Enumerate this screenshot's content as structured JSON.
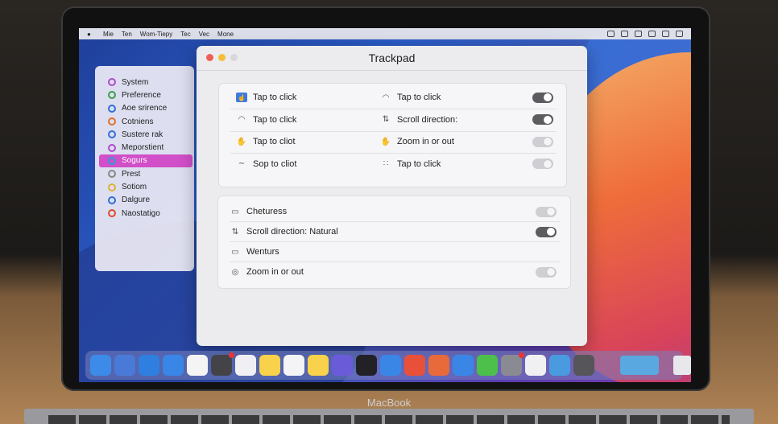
{
  "menubar": {
    "items": [
      "Mie",
      "Ten",
      "Wom-Tiepy",
      "Tec",
      "Vec",
      "Mone"
    ]
  },
  "sidebar": {
    "items": [
      {
        "label": "System",
        "color": "#b04ad0"
      },
      {
        "label": "Preference",
        "color": "#3aa04a"
      },
      {
        "label": "Aoe srirence",
        "color": "#2f6fd8"
      },
      {
        "label": "Cotniens",
        "color": "#e07030"
      },
      {
        "label": "Sustere rak",
        "color": "#2f6fd8"
      },
      {
        "label": "Meporstient",
        "color": "#b04ad0"
      },
      {
        "label": "Sogurs",
        "color": "#2f9ad8",
        "selected": true
      },
      {
        "label": "Prest",
        "color": "#888888"
      },
      {
        "label": "Sotiom",
        "color": "#e0b030"
      },
      {
        "label": "Dalgure",
        "color": "#2f6fd8"
      },
      {
        "label": "Naostatigo",
        "color": "#e04a2a"
      }
    ]
  },
  "window": {
    "title": "Trackpad",
    "group1": [
      {
        "left": {
          "icon": "tap-icon",
          "label": "Tap to click"
        },
        "right": {
          "icon": "tap-gesture-icon",
          "label": "Tap to click",
          "toggle": "on"
        }
      },
      {
        "left": {
          "icon": "tap-gesture-icon",
          "label": "Tap to click"
        },
        "right": {
          "icon": "scroll-icon",
          "label": "Scroll direction:",
          "toggle": "on"
        }
      },
      {
        "left": {
          "icon": "hand-icon",
          "label": "Tap to cliot"
        },
        "right": {
          "icon": "hand-icon",
          "label": "Zoom in or out",
          "toggle": "off"
        }
      },
      {
        "left": {
          "icon": "swipe-icon",
          "label": "Sop to cliot"
        },
        "right": {
          "icon": "dots-icon",
          "label": "Tap to click",
          "toggle": "off"
        }
      }
    ],
    "group2": [
      {
        "icon": "trackpad-icon",
        "label": "Cheturess",
        "toggle": "off"
      },
      {
        "icon": "scroll-icon",
        "label": "Scroll direction: Natural",
        "toggle": "on"
      },
      {
        "icon": "trackpad-icon",
        "label": "Wenturs",
        "toggle": null
      },
      {
        "icon": "zoom-icon",
        "label": "Zoom in or out",
        "toggle": "off"
      }
    ]
  },
  "dock": {
    "icons": [
      {
        "name": "finder-icon",
        "color": "#3d8be8"
      },
      {
        "name": "launchpad-icon",
        "color": "#4a7ad8"
      },
      {
        "name": "safari-icon",
        "color": "#2f7fe0"
      },
      {
        "name": "safari-icon",
        "color": "#3a86e6"
      },
      {
        "name": "reminders-icon",
        "color": "#f4f4f4"
      },
      {
        "name": "facetime-icon",
        "color": "#444448",
        "badge": true
      },
      {
        "name": "photos-icon",
        "color": "#f0f0f4"
      },
      {
        "name": "notes-icon",
        "color": "#f7d24a"
      },
      {
        "name": "calendar-icon",
        "color": "#f4f4f6"
      },
      {
        "name": "notes-icon",
        "color": "#f7d24a"
      },
      {
        "name": "music-icon",
        "color": "#6a5cd8"
      },
      {
        "name": "terminal-icon",
        "color": "#222226"
      },
      {
        "name": "safari-icon",
        "color": "#3a86e6"
      },
      {
        "name": "app-store-icon",
        "color": "#e8503a"
      },
      {
        "name": "chrome-icon",
        "color": "#e86a3a"
      },
      {
        "name": "safari-icon",
        "color": "#3a86e6"
      },
      {
        "name": "numbers-icon",
        "color": "#4cc04a"
      },
      {
        "name": "filter-icon",
        "color": "#8a8a92",
        "badge": true
      },
      {
        "name": "clock-icon",
        "color": "#f0f0f2"
      },
      {
        "name": "maps-icon",
        "color": "#4a9ae0"
      },
      {
        "name": "settings-icon",
        "color": "#55555a"
      }
    ]
  },
  "brand": "MacBook"
}
